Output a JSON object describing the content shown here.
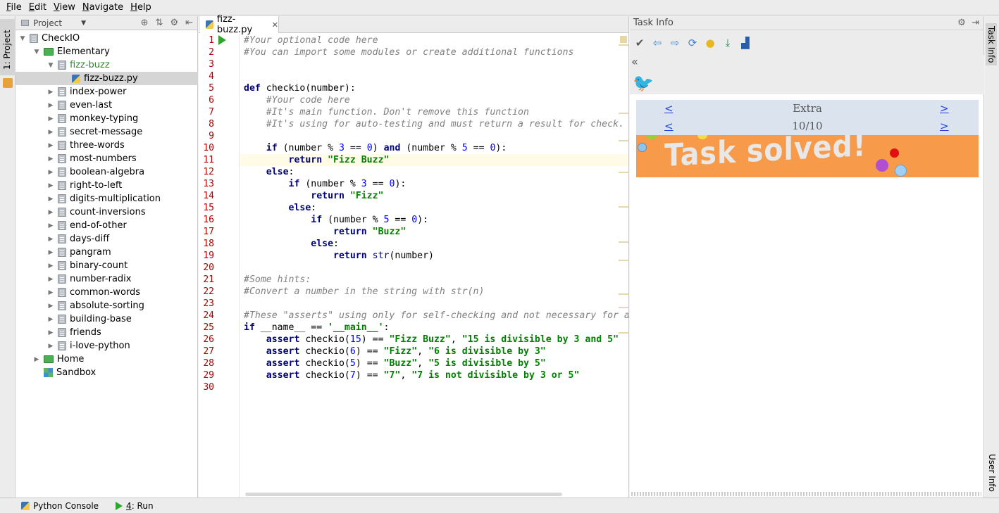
{
  "menu": [
    "File",
    "Edit",
    "View",
    "Navigate",
    "Help"
  ],
  "left_strip": {
    "project_tab": "1: Project"
  },
  "project": {
    "header": "Project",
    "tree": [
      {
        "label": "CheckIO",
        "depth": 0,
        "icon": "folder",
        "expanded": true
      },
      {
        "label": "Elementary",
        "depth": 1,
        "icon": "module-green",
        "expanded": true
      },
      {
        "label": "fizz-buzz",
        "depth": 2,
        "icon": "folder",
        "expanded": true,
        "green": true
      },
      {
        "label": "fizz-buzz.py",
        "depth": 3,
        "icon": "python-file",
        "selected": true
      },
      {
        "label": "index-power",
        "depth": 2,
        "icon": "folder"
      },
      {
        "label": "even-last",
        "depth": 2,
        "icon": "folder"
      },
      {
        "label": "monkey-typing",
        "depth": 2,
        "icon": "folder"
      },
      {
        "label": "secret-message",
        "depth": 2,
        "icon": "folder"
      },
      {
        "label": "three-words",
        "depth": 2,
        "icon": "folder"
      },
      {
        "label": "most-numbers",
        "depth": 2,
        "icon": "folder"
      },
      {
        "label": "boolean-algebra",
        "depth": 2,
        "icon": "folder"
      },
      {
        "label": "right-to-left",
        "depth": 2,
        "icon": "folder"
      },
      {
        "label": "digits-multiplication",
        "depth": 2,
        "icon": "folder"
      },
      {
        "label": "count-inversions",
        "depth": 2,
        "icon": "folder"
      },
      {
        "label": "end-of-other",
        "depth": 2,
        "icon": "folder"
      },
      {
        "label": "days-diff",
        "depth": 2,
        "icon": "folder"
      },
      {
        "label": "pangram",
        "depth": 2,
        "icon": "folder"
      },
      {
        "label": "binary-count",
        "depth": 2,
        "icon": "folder"
      },
      {
        "label": "number-radix",
        "depth": 2,
        "icon": "folder"
      },
      {
        "label": "common-words",
        "depth": 2,
        "icon": "folder"
      },
      {
        "label": "absolute-sorting",
        "depth": 2,
        "icon": "folder"
      },
      {
        "label": "building-base",
        "depth": 2,
        "icon": "folder"
      },
      {
        "label": "friends",
        "depth": 2,
        "icon": "folder"
      },
      {
        "label": "i-love-python",
        "depth": 2,
        "icon": "folder"
      },
      {
        "label": "Home",
        "depth": 1,
        "icon": "module-green"
      },
      {
        "label": "Sandbox",
        "depth": 1,
        "icon": "sandbox",
        "leaf": true
      }
    ]
  },
  "editor": {
    "tab_label": "fizz-buzz.py",
    "line_count": 30,
    "code": [
      [
        [
          "cm",
          "#Your optional code here"
        ]
      ],
      [
        [
          "cm",
          "#You can import some modules or create additional functions"
        ]
      ],
      [],
      [],
      [
        [
          "kw",
          "def "
        ],
        [
          "",
          "checkio(number):"
        ]
      ],
      [
        [
          "",
          "    "
        ],
        [
          "cm",
          "#Your code here"
        ]
      ],
      [
        [
          "",
          "    "
        ],
        [
          "cm",
          "#It's main function. Don't remove this function"
        ]
      ],
      [
        [
          "",
          "    "
        ],
        [
          "cm",
          "#It's using for auto-testing and must return a result for check."
        ]
      ],
      [],
      [
        [
          "",
          "    "
        ],
        [
          "kw",
          "if "
        ],
        [
          "",
          "(number % "
        ],
        [
          "nu",
          "3"
        ],
        [
          "",
          " == "
        ],
        [
          "nu",
          "0"
        ],
        [
          "",
          ") "
        ],
        [
          "kw",
          "and "
        ],
        [
          "",
          "(number % "
        ],
        [
          "nu",
          "5"
        ],
        [
          "",
          " == "
        ],
        [
          "nu",
          "0"
        ],
        [
          "",
          "):"
        ]
      ],
      [
        [
          "",
          "        "
        ],
        [
          "kw",
          "return "
        ],
        [
          "st",
          "\"Fizz Buzz\""
        ]
      ],
      [
        [
          "",
          "    "
        ],
        [
          "kw",
          "else"
        ],
        [
          "",
          ":"
        ]
      ],
      [
        [
          "",
          "        "
        ],
        [
          "kw",
          "if "
        ],
        [
          "",
          "(number % "
        ],
        [
          "nu",
          "3"
        ],
        [
          "",
          " == "
        ],
        [
          "nu",
          "0"
        ],
        [
          "",
          "):"
        ]
      ],
      [
        [
          "",
          "            "
        ],
        [
          "kw",
          "return "
        ],
        [
          "st",
          "\"Fizz\""
        ]
      ],
      [
        [
          "",
          "        "
        ],
        [
          "kw",
          "else"
        ],
        [
          "",
          ":"
        ]
      ],
      [
        [
          "",
          "            "
        ],
        [
          "kw",
          "if "
        ],
        [
          "",
          "(number % "
        ],
        [
          "nu",
          "5"
        ],
        [
          "",
          " == "
        ],
        [
          "nu",
          "0"
        ],
        [
          "",
          "):"
        ]
      ],
      [
        [
          "",
          "                "
        ],
        [
          "kw",
          "return "
        ],
        [
          "st",
          "\"Buzz\""
        ]
      ],
      [
        [
          "",
          "            "
        ],
        [
          "kw",
          "else"
        ],
        [
          "",
          ":"
        ]
      ],
      [
        [
          "",
          "                "
        ],
        [
          "kw",
          "return "
        ],
        [
          "bi",
          "str"
        ],
        [
          "",
          "(number)"
        ]
      ],
      [],
      [
        [
          "cm",
          "#Some hints:"
        ]
      ],
      [
        [
          "cm",
          "#Convert a number in the string with str(n)"
        ]
      ],
      [],
      [
        [
          "cm",
          "#These \"asserts\" using only for self-checking and not necessary for a"
        ]
      ],
      [
        [
          "kw",
          "if "
        ],
        [
          "",
          "__name__ == "
        ],
        [
          "st",
          "'__main__'"
        ],
        [
          "",
          ":"
        ]
      ],
      [
        [
          "",
          "    "
        ],
        [
          "kw",
          "assert "
        ],
        [
          "",
          "checkio("
        ],
        [
          "nu",
          "15"
        ],
        [
          "",
          ") == "
        ],
        [
          "st",
          "\"Fizz Buzz\""
        ],
        [
          "",
          ", "
        ],
        [
          "st",
          "\"15 is divisible by 3 and 5\""
        ]
      ],
      [
        [
          "",
          "    "
        ],
        [
          "kw",
          "assert "
        ],
        [
          "",
          "checkio("
        ],
        [
          "nu",
          "6"
        ],
        [
          "",
          ") == "
        ],
        [
          "st",
          "\"Fizz\""
        ],
        [
          "",
          ", "
        ],
        [
          "st",
          "\"6 is divisible by 3\""
        ]
      ],
      [
        [
          "",
          "    "
        ],
        [
          "kw",
          "assert "
        ],
        [
          "",
          "checkio("
        ],
        [
          "nu",
          "5"
        ],
        [
          "",
          ") == "
        ],
        [
          "st",
          "\"Buzz\""
        ],
        [
          "",
          ", "
        ],
        [
          "st",
          "\"5 is divisible by 5\""
        ]
      ],
      [
        [
          "",
          "    "
        ],
        [
          "kw",
          "assert "
        ],
        [
          "",
          "checkio("
        ],
        [
          "nu",
          "7"
        ],
        [
          "",
          ") == "
        ],
        [
          "st",
          "\"7\""
        ],
        [
          "",
          ", "
        ],
        [
          "st",
          "\"7 is not divisible by 3 or 5\""
        ]
      ],
      []
    ]
  },
  "task_info": {
    "header": "Task Info",
    "toolbar_icons": [
      "check-icon",
      "back-arrow-icon",
      "forward-arrow-icon",
      "refresh-icon",
      "lightbulb-icon",
      "download-icon",
      "share-icon"
    ],
    "collapse": "«",
    "nav_rows": [
      {
        "prev": "<",
        "label": "Extra",
        "next": ">"
      },
      {
        "prev": "<",
        "label": "10/10",
        "next": ">"
      }
    ],
    "banner_text": "Task solved!"
  },
  "right_strip": {
    "task_info_tab": "Task Info",
    "user_info_tab": "User Info"
  },
  "statusbar": {
    "python_console": "Python Console",
    "run_num": "4",
    "run_label": ": Run"
  },
  "colors": {
    "banner": "#f79a4a",
    "nav_bg": "#dbe3ef",
    "link": "#1a3de0"
  }
}
